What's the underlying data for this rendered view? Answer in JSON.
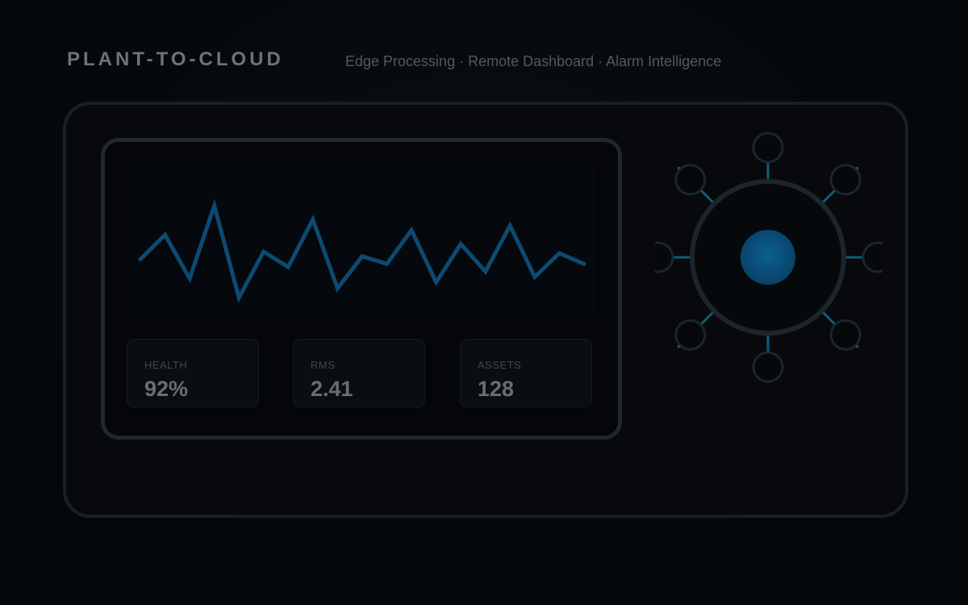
{
  "header": {
    "brand": "PLANT-TO-CLOUD",
    "tagline": "Edge Processing · Remote Dashboard · Alarm Intelligence"
  },
  "waveform": {
    "color": "#0d4a73",
    "values": [
      0.3,
      0.62,
      0.05,
      1.0,
      -0.2,
      0.4,
      0.2,
      0.82,
      -0.08,
      0.34,
      0.24,
      0.68,
      0.0,
      0.5,
      0.14,
      0.74,
      0.07,
      0.38,
      0.24
    ]
  },
  "stats": [
    {
      "label": "HEALTH",
      "value": "92%"
    },
    {
      "label": "RMS",
      "value": "2.41"
    },
    {
      "label": "ASSETS",
      "value": "128"
    }
  ],
  "hub": {
    "core_color": "#0a4f7a",
    "ring_color": "#1d252c",
    "accent_color": "#0e5e7c",
    "satellite_count": 8
  },
  "colors": {
    "background": "#05080b",
    "frame_border": "#1b2026",
    "monitor_border": "#1f272f"
  }
}
